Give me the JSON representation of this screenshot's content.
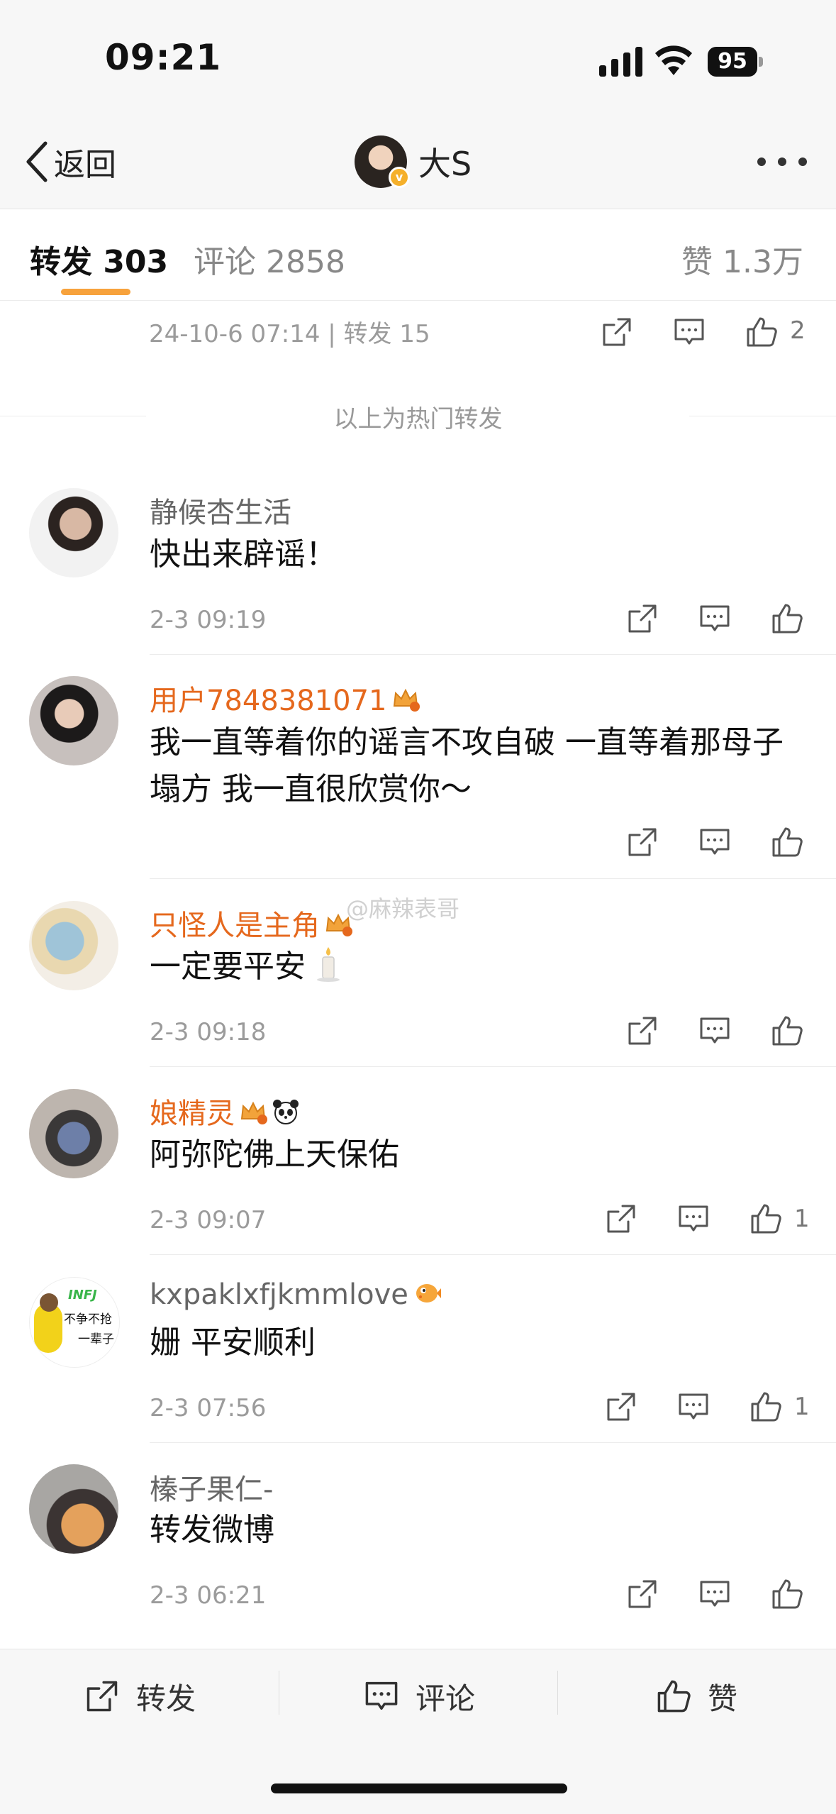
{
  "status_bar": {
    "time": "09:21",
    "battery": "95"
  },
  "nav": {
    "back_label": "返回",
    "title": "大S",
    "more_icon": "ellipsis-icon"
  },
  "tabs": {
    "repost": "转发 303",
    "comment": "评论 2858",
    "like": "赞 1.3万"
  },
  "hot_repost": {
    "meta": "24-10-6 07:14 | 转发 15",
    "like_count": "2"
  },
  "hot_label": "以上为热门转发",
  "watermark": "@麻辣表哥",
  "comments": [
    {
      "user": "静候杏生活",
      "text": "快出来辟谣！",
      "time": "2-3 09:19",
      "likes": ""
    },
    {
      "user": "用户7848381071",
      "text": "我一直等着你的谣言不攻自破 一直等着那母子塌方 我一直很欣赏你～",
      "time": "",
      "likes": ""
    },
    {
      "user": "只怪人是主角",
      "text": "一定要平安",
      "time": "2-3 09:18",
      "likes": ""
    },
    {
      "user": "娘精灵",
      "text": "阿弥陀佛上天保佑",
      "time": "2-3 09:07",
      "likes": "1"
    },
    {
      "user": "kxpaklxfjkmmlove",
      "text": "姗 平安顺利",
      "time": "2-3 07:56",
      "likes": "1"
    },
    {
      "user": "榛子果仁-",
      "text": "转发微博",
      "time": "2-3 06:21",
      "likes": ""
    }
  ],
  "avatar5_text": {
    "line1": "INFJ",
    "line2": "不争不抢",
    "line3": "一辈子"
  },
  "bottom_bar": {
    "repost": "转发",
    "comment": "评论",
    "like": "赞"
  },
  "colors": {
    "accent": "#f7a23c",
    "vip_name": "#e5681d",
    "meta": "#9b9b9b"
  }
}
